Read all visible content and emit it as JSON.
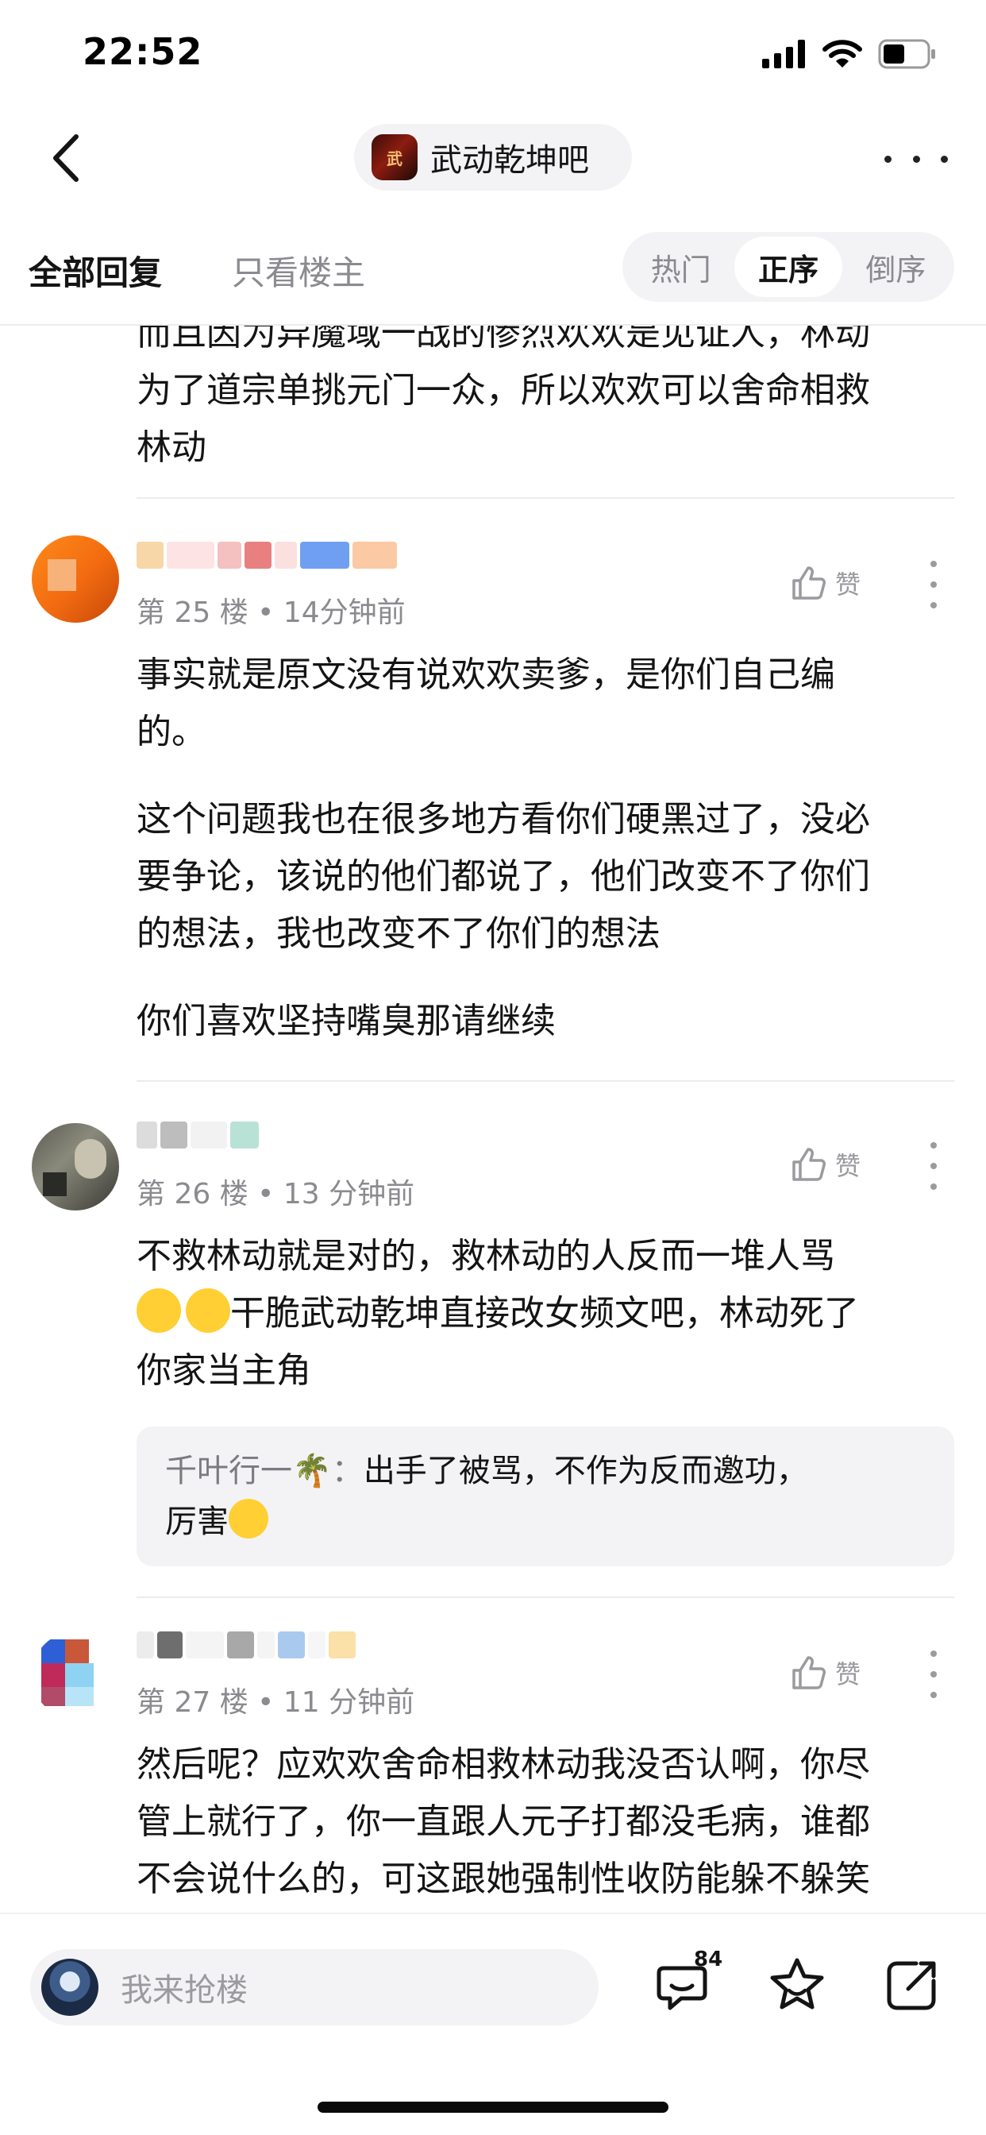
{
  "status_bar": {
    "time": "22:52"
  },
  "nav": {
    "forum_name": "武动乾坤吧"
  },
  "filter": {
    "tab_all": "全部回复",
    "tab_owner": "只看楼主",
    "sort_options": [
      "热门",
      "正序",
      "倒序"
    ],
    "sort_active": "正序"
  },
  "posts": {
    "prev": {
      "line1": "而且因为异魔域一战的惨烈欢欢是见证人，林动",
      "line2": "为了道宗单挑元门一众，所以欢欢可以舍命相救",
      "line3": "林动"
    },
    "p25": {
      "floor": "第 25 楼",
      "time": "14分钟前",
      "like_label": "赞",
      "para1_l1": "事实就是原文没有说欢欢卖爹，是你们自己编",
      "para1_l2": "的。",
      "para2_l1": "这个问题我也在很多地方看你们硬黑过了，没必",
      "para2_l2": "要争论，该说的他们都说了，他们改变不了你们",
      "para2_l3": "的想法，我也改变不了你们的想法",
      "para3": "你们喜欢坚持嘴臭那请继续"
    },
    "p26": {
      "floor": "第 26 楼",
      "time": "13 分钟前",
      "like_label": "赞",
      "l1": "不救林动就是对的，救林动的人反而一堆人骂",
      "l2": "干脆武动乾坤直接改女频文吧，林动死了",
      "l3": "你家当主角",
      "reply_author": "千叶行一🌴：",
      "reply_l1": "出手了被骂，不作为反而邀功，",
      "reply_l2": "厉害"
    },
    "p27": {
      "floor": "第 27 楼",
      "time": "11 分钟前",
      "like_label": "赞",
      "l1": "然后呢？应欢欢舍命相救林动我没否认啊，你尽",
      "l2": "管上就行了，你一直跟人元子打都没毛病，谁都",
      "l3": "不会说什么的，可这跟她强制性收防能躲不躲笑"
    }
  },
  "bottom_bar": {
    "input_placeholder": "我来抢楼",
    "comment_count": "84"
  }
}
